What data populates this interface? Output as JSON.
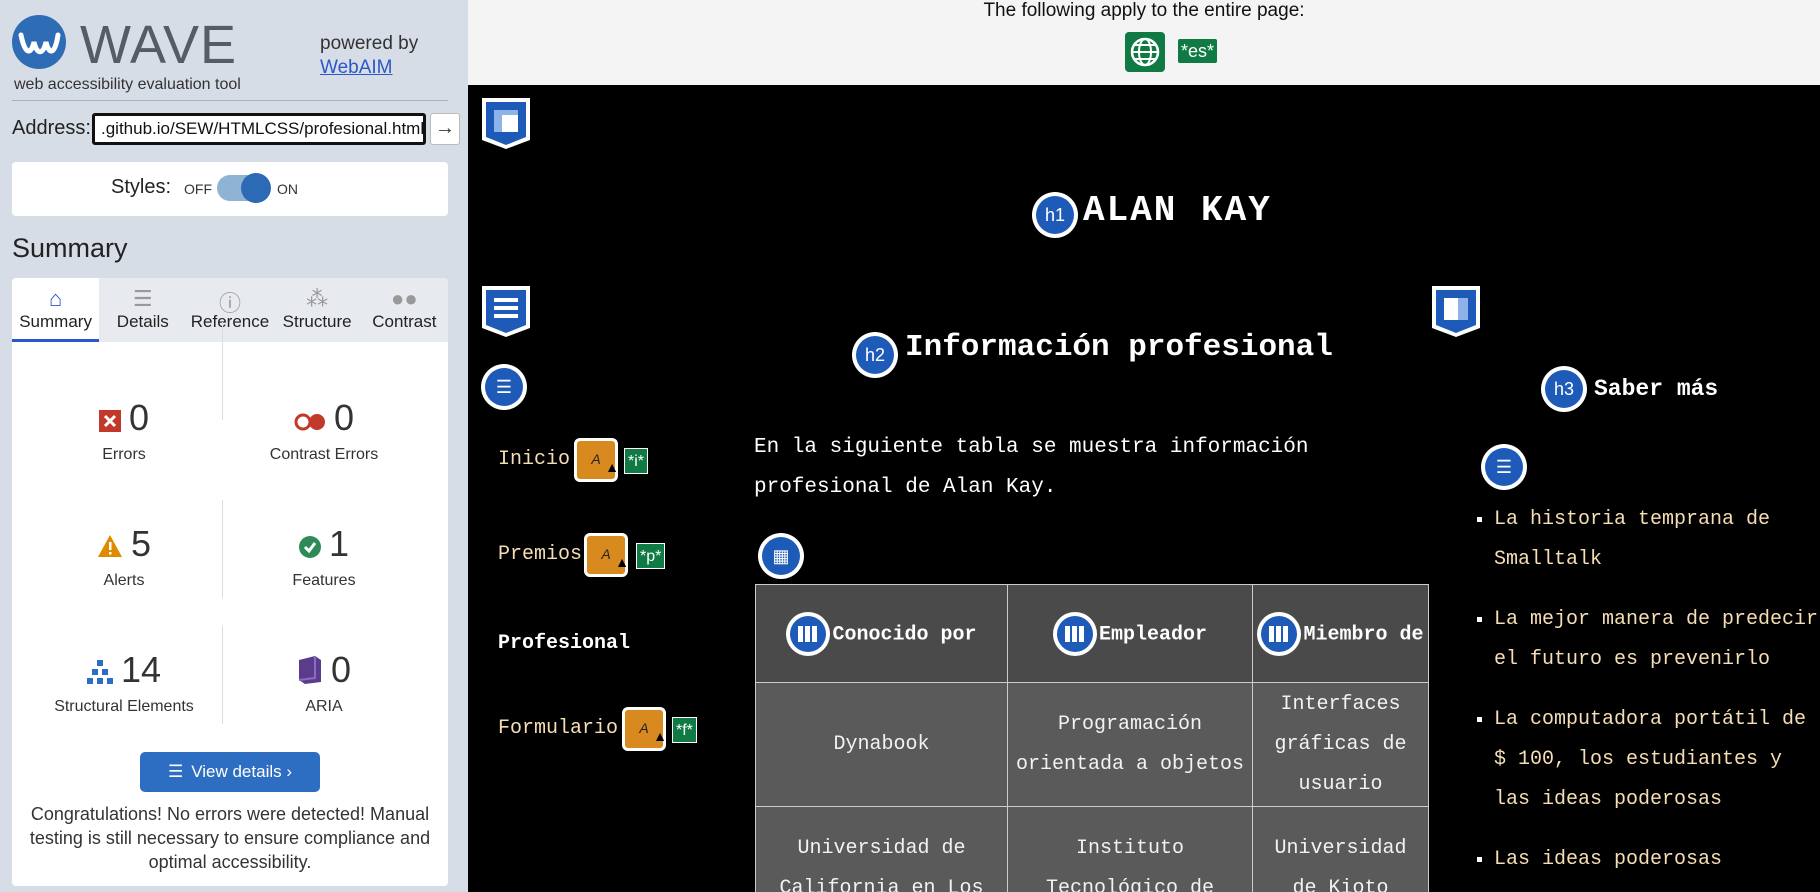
{
  "wave": {
    "logo_word": "WAVE",
    "tagline": "web accessibility evaluation tool",
    "powered_by": "powered by",
    "webaim_link": "WebAIM",
    "address_label": "Address:",
    "address_value": ".github.io/SEW/HTMLCSS/profesional.html",
    "go_icon": "arrow-right-icon",
    "styles_label": "Styles:",
    "styles_off": "OFF",
    "styles_on": "ON",
    "summary_heading": "Summary",
    "tabs": [
      {
        "label": "Summary",
        "icon": "home-icon",
        "active": true
      },
      {
        "label": "Details",
        "icon": "list-icon",
        "active": false
      },
      {
        "label": "Reference",
        "icon": "info-icon",
        "active": false
      },
      {
        "label": "Structure",
        "icon": "hierarchy-icon",
        "active": false
      },
      {
        "label": "Contrast",
        "icon": "contrast-icon",
        "active": false
      }
    ],
    "stats": {
      "errors": {
        "count": "0",
        "label": "Errors",
        "color": "#c0392b"
      },
      "contrast_errors": {
        "count": "0",
        "label": "Contrast Errors",
        "color": "#c0392b"
      },
      "alerts": {
        "count": "5",
        "label": "Alerts",
        "color": "#e08a00"
      },
      "features": {
        "count": "1",
        "label": "Features",
        "color": "#2e8b57"
      },
      "structural": {
        "count": "14",
        "label": "Structural Elements",
        "color": "#2e6ec2"
      },
      "aria": {
        "count": "0",
        "label": "ARIA",
        "color": "#5b3c8c"
      }
    },
    "view_details": "View details ›",
    "congrats": "Congratulations! No errors were detected! Manual testing is still necessary to ensure compliance and optimal accessibility."
  },
  "page": {
    "top_note": "The following apply to the entire page:",
    "lang_tag": "*es*",
    "h1": "ALAN KAY",
    "h1_badge": "h1",
    "h2": "Información profesional",
    "h2_badge": "h2",
    "h3": "Saber más",
    "h3_badge": "h3",
    "nav": [
      {
        "label": "Inicio",
        "tag": "*i*"
      },
      {
        "label": "Premios",
        "tag": "*p*"
      },
      {
        "label": "Profesional",
        "tag": ""
      },
      {
        "label": "Formulario",
        "tag": "*f*"
      }
    ],
    "alert_letter": "A",
    "intro": "En la siguiente tabla se muestra información profesional de Alan Kay.",
    "table": {
      "headers": [
        "Conocido por",
        "Empleador",
        "Miembro de"
      ],
      "rows": [
        [
          "Dynabook",
          "Programación orientada a objetos",
          "Interfaces gráficas de usuario"
        ],
        [
          "Universidad de California en Los",
          "Instituto Tecnológico de",
          "Universidad de Kioto"
        ]
      ]
    },
    "more_links": [
      "La historia temprana de Smalltalk",
      "La mejor manera de predecir el futuro es prevenirlo",
      "La computadora portátil de $ 100, los estudiantes y las ideas poderosas",
      "Las ideas poderosas"
    ]
  }
}
